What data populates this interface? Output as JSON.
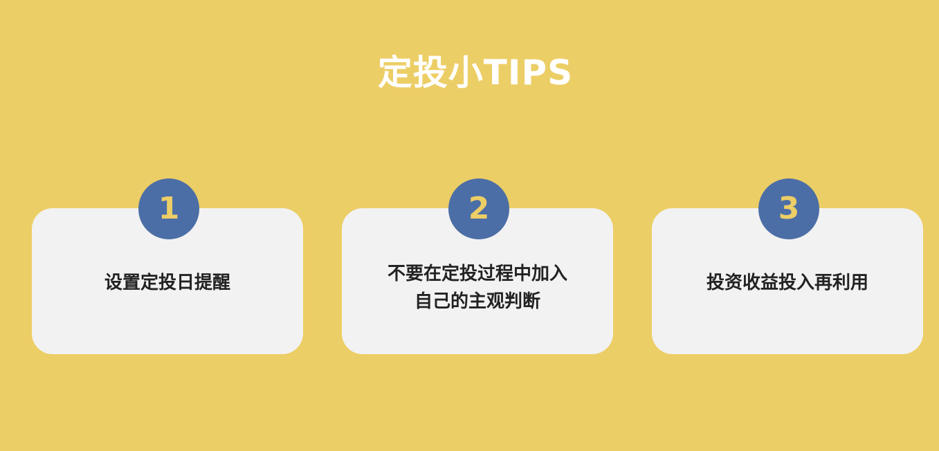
{
  "title": "定投小TIPS",
  "colors": {
    "background": "#ECCE66",
    "card": "#F2F2F2",
    "badge": "#4C6EA6",
    "badge_number": "#ECCE66",
    "title": "#FFFFFF",
    "card_text": "#222222"
  },
  "tips": [
    {
      "number": "1",
      "lines": [
        "设置定投日提醒"
      ]
    },
    {
      "number": "2",
      "lines": [
        "不要在定投过程中加入",
        "自己的主观判断"
      ]
    },
    {
      "number": "3",
      "lines": [
        "投资收益投入再利用"
      ]
    }
  ]
}
